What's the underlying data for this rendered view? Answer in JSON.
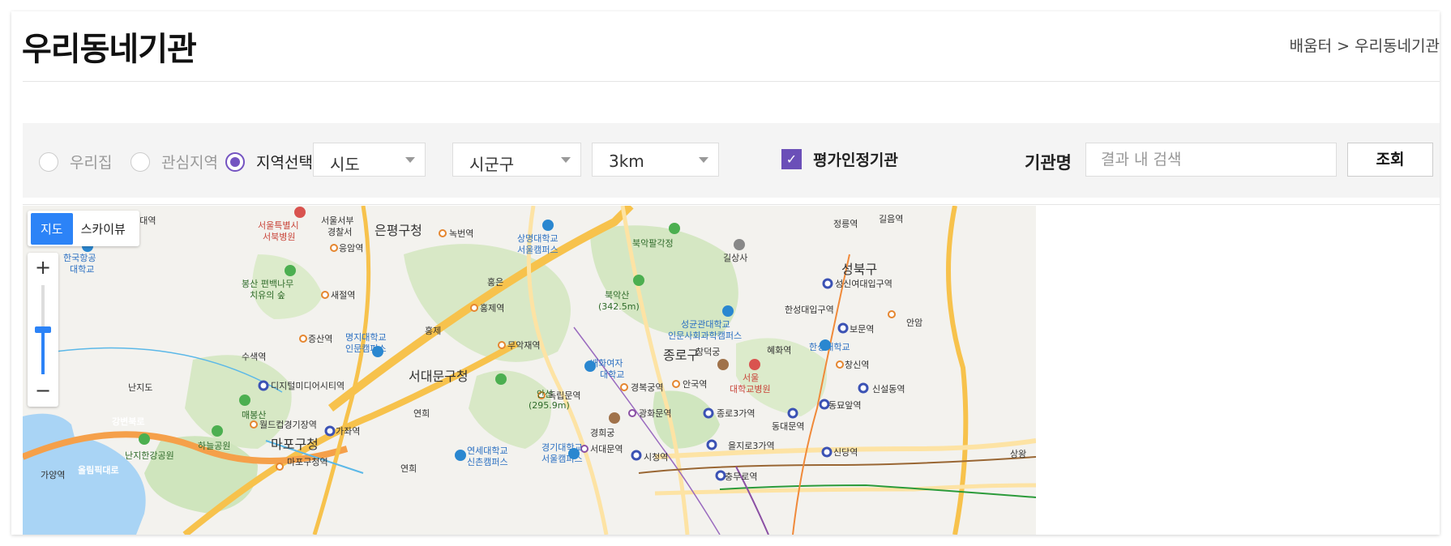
{
  "header": {
    "title": "우리동네기관",
    "breadcrumb": "배움터 > 우리동네기관"
  },
  "filter": {
    "radios": [
      {
        "label": "우리집",
        "selected": false
      },
      {
        "label": "관심지역",
        "selected": false
      },
      {
        "label": "지역선택",
        "selected": true
      }
    ],
    "selects": {
      "sido": "시도",
      "sigungu": "시군구",
      "radius": "3km"
    },
    "checkbox": {
      "label": "평가인정기관",
      "checked": true
    },
    "name_label": "기관명",
    "search_placeholder": "결과 내 검색",
    "search_button": "조회"
  },
  "map": {
    "toggle": {
      "map": "지도",
      "skyview": "스카이뷰"
    },
    "zoom_in": "+",
    "zoom_out": "−",
    "districts": [
      "은평구청",
      "서대문구청",
      "마포구청",
      "종로구",
      "성북구"
    ],
    "labels": {
      "l01": "항공대역",
      "l02": "서울특별시",
      "l03": "서북병원",
      "l04": "서울서부",
      "l05": "경찰서",
      "l06": "녹번역",
      "l07": "상명대학교",
      "l08": "서울캠퍼스",
      "l09": "북악팔각정",
      "l10": "길상사",
      "l11": "정릉역",
      "l12": "길음역",
      "l13": "한국항공",
      "l14": "대학교",
      "l15": "응암역",
      "l16": "봉산 편백나무",
      "l17": "치유의 숲",
      "l18": "새절역",
      "l19": "홍은",
      "l20": "북악산",
      "l21": "(342.5m)",
      "l22": "성신여대입구역",
      "l23": "홍제역",
      "l24": "홍제",
      "l25": "한성대입구역",
      "l26": "보문역",
      "l27": "성균관대학교",
      "l28": "인문사회과학캠퍼스",
      "l29": "명지대학교",
      "l30": "인문캠퍼스",
      "l31": "증산역",
      "l32": "무악재역",
      "l33": "배화여자",
      "l34": "대학교",
      "l35": "혜화역",
      "l36": "한성대학교",
      "l37": "창덕궁",
      "l38": "수색역",
      "l39": "서울",
      "l40": "대학교병원",
      "l41": "창신역",
      "l42": "난지도",
      "l43": "디지털미디어시티역",
      "l44": "안산",
      "l45": "(295.9m)",
      "l46": "독립문역",
      "l47": "경복궁역",
      "l48": "안국역",
      "l49": "신설동역",
      "l50": "매봉산",
      "l51": "연희",
      "l52": "광화문역",
      "l53": "종로3가역",
      "l54": "동묘앞역",
      "l55": "월드컵경기장역",
      "l56": "가좌역",
      "l57": "경희궁",
      "l58": "동대문역",
      "l59": "하늘공원",
      "l60": "난지한강공원",
      "l61": "연세대학교",
      "l62": "신촌캠퍼스",
      "l63": "경기대학교",
      "l64": "서울캠퍼스",
      "l65": "서대문역",
      "l66": "을지로3가역",
      "l67": "신당역",
      "l68": "시청역",
      "l69": "마포구청역",
      "l70": "가양역",
      "l71": "연희",
      "l72": "강변북로",
      "l73": "올림픽대로",
      "l74": "충무로역",
      "l75": "안암",
      "l76": "상왕"
    }
  }
}
